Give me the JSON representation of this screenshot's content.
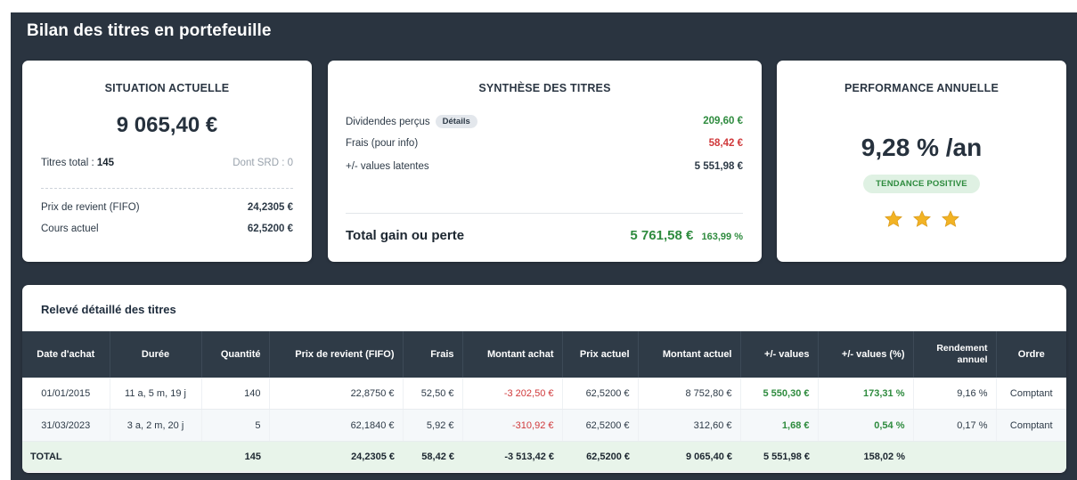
{
  "page": {
    "title": "Bilan des titres en portefeuille"
  },
  "situation": {
    "title": "SITUATION ACTUELLE",
    "amount": "9 065,40 €",
    "titres_label": "Titres total : ",
    "titres_value": "145",
    "srd_label": "Dont SRD : 0",
    "prix_revient_label": "Prix de revient (FIFO)",
    "prix_revient_value": "24,2305 €",
    "cours_label": "Cours actuel",
    "cours_value": "62,5200 €"
  },
  "synthese": {
    "title": "SYNTHÈSE DES TITRES",
    "dividendes_label": "Dividendes perçus",
    "details_label": "Détails",
    "dividendes_value": "209,60 €",
    "frais_label": "Frais (pour info)",
    "frais_value": "58,42 €",
    "values_label": "+/- values latentes",
    "values_value": "5 551,98 €",
    "total_label": "Total gain ou perte",
    "total_value": "5 761,58 €",
    "total_pct": "163,99 %"
  },
  "performance": {
    "title": "PERFORMANCE ANNUELLE",
    "value": "9,28 % /an",
    "trend": "TENDANCE POSITIVE",
    "stars": 3,
    "star_icon": "star-icon",
    "star_color": "#f2b324"
  },
  "releve": {
    "title": "Relevé détaillé des titres",
    "columns": [
      "Date d'achat",
      "Durée",
      "Quantité",
      "Prix de revient (FIFO)",
      "Frais",
      "Montant achat",
      "Prix actuel",
      "Montant actuel",
      "+/- values",
      "+/- values (%)",
      "Rendement annuel",
      "Ordre"
    ],
    "rows": [
      [
        "01/01/2015",
        "11 a, 5 m, 19 j",
        "140",
        "22,8750 €",
        "52,50 €",
        "-3 202,50 €",
        "62,5200 €",
        "8 752,80 €",
        "5 550,30 €",
        "173,31 %",
        "9,16 %",
        "Comptant"
      ],
      [
        "31/03/2023",
        "3 a, 2 m, 20 j",
        "5",
        "62,1840 €",
        "5,92 €",
        "-310,92 €",
        "62,5200 €",
        "312,60 €",
        "1,68 €",
        "0,54 %",
        "0,17 %",
        "Comptant"
      ]
    ],
    "total": [
      "TOTAL",
      "",
      "145",
      "24,2305 €",
      "58,42 €",
      "-3 513,42 €",
      "62,5200 €",
      "9 065,40 €",
      "5 551,98 €",
      "158,02 %",
      "",
      ""
    ]
  },
  "colors": {
    "background": "#2a3440",
    "positive": "#2e8b3e",
    "negative": "#d0393b",
    "header": "#2f3b47",
    "total_row": "#e8f4ea"
  }
}
